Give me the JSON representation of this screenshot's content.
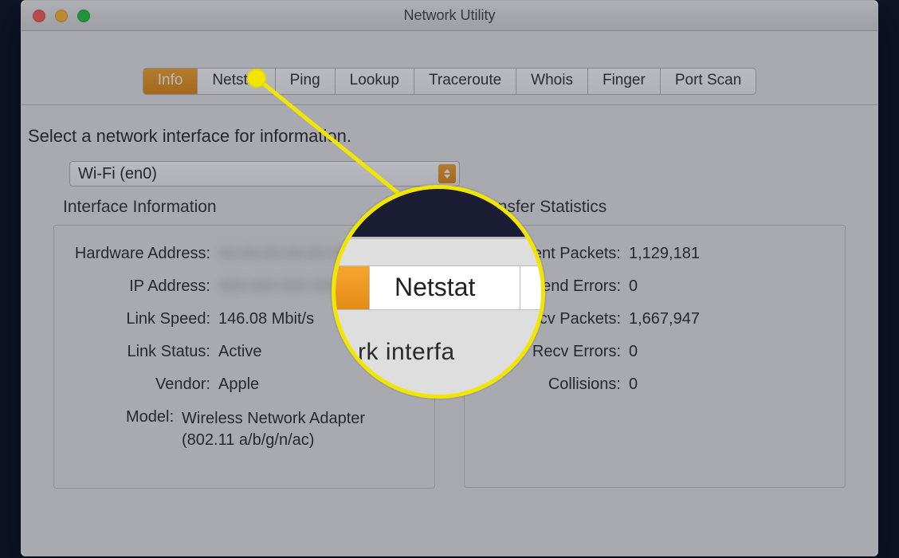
{
  "window_title": "Network Utility",
  "tabs": [
    {
      "label": "Info",
      "selected": true
    },
    {
      "label": "Netstat",
      "selected": false
    },
    {
      "label": "Ping",
      "selected": false
    },
    {
      "label": "Lookup",
      "selected": false
    },
    {
      "label": "Traceroute",
      "selected": false
    },
    {
      "label": "Whois",
      "selected": false
    },
    {
      "label": "Finger",
      "selected": false
    },
    {
      "label": "Port Scan",
      "selected": false
    }
  ],
  "prompt": "Select a network interface for information.",
  "interface_select": {
    "value": "Wi-Fi (en0)"
  },
  "interface_info": {
    "heading": "Interface Information",
    "hardware_address": {
      "label": "Hardware Address:",
      "value": "",
      "redacted": true
    },
    "ip_address": {
      "label": "IP Address:",
      "value": "",
      "redacted": true
    },
    "link_speed": {
      "label": "Link Speed:",
      "value": "146.08 Mbit/s"
    },
    "link_status": {
      "label": "Link Status:",
      "value": "Active"
    },
    "vendor": {
      "label": "Vendor:",
      "value": "Apple"
    },
    "model": {
      "label": "Model:",
      "value": "Wireless Network Adapter (802.11 a/b/g/n/ac)"
    }
  },
  "transfer_stats": {
    "heading": "Transfer Statistics",
    "sent_packets": {
      "label": "Sent Packets:",
      "value": "1,129,181"
    },
    "send_errors": {
      "label": "Send Errors:",
      "value": "0"
    },
    "recv_packets": {
      "label": "Recv Packets:",
      "value": "1,667,947"
    },
    "recv_errors": {
      "label": "Recv Errors:",
      "value": "0"
    },
    "collisions": {
      "label": "Collisions:",
      "value": "0"
    }
  },
  "callout": {
    "tab_label": "Netstat",
    "subtext": "rk interfa"
  }
}
